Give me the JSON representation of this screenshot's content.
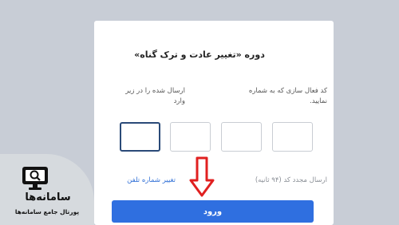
{
  "course_title": "دوره «تغییر عادت و ترک گناه»",
  "instructions": {
    "right": "کد فعال سازی که به شماره ارسال شده را در زیر وارد نمایید.",
    "left": "ارسال شده را در زیر وارد"
  },
  "code_inputs": [
    {
      "value": "",
      "active": false
    },
    {
      "value": "",
      "active": false
    },
    {
      "value": "",
      "active": false
    },
    {
      "value": "",
      "active": true
    }
  ],
  "resend_label": "ارسال مجدد کد (۹۴ ثانیه)",
  "change_phone_label": "تغییر شماره تلفن",
  "login_button_label": "ورود",
  "logo": {
    "name": "سامانه‌ها",
    "subtitle": "پورتال جامع سامانه‌ها"
  },
  "colors": {
    "background": "#c8cdd6",
    "primary": "#2f6fe0",
    "link": "#2f6fd6",
    "arrow": "#e02020",
    "active_box_border": "#2a4a78"
  }
}
